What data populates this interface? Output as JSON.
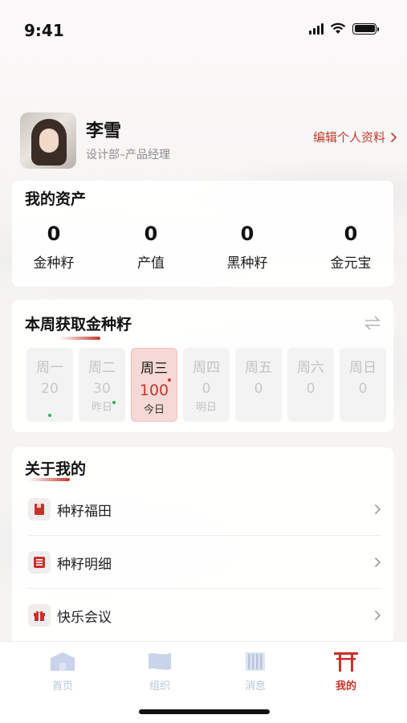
{
  "status": {
    "time": "9:41"
  },
  "profile": {
    "name": "李雪",
    "department": "设计部–产品经理",
    "edit_label": "编辑个人资料"
  },
  "assets": {
    "title": "我的资产",
    "items": [
      {
        "value": "0",
        "label": "金种籽"
      },
      {
        "value": "0",
        "label": "产值"
      },
      {
        "value": "0",
        "label": "黑种籽"
      },
      {
        "value": "0",
        "label": "金元宝"
      }
    ]
  },
  "weekly": {
    "title": "本周获取金种籽",
    "days": [
      {
        "name": "周一",
        "value": "20",
        "sub": ""
      },
      {
        "name": "周二",
        "value": "30",
        "sub": "昨日"
      },
      {
        "name": "周三",
        "value": "100",
        "sub": "今日"
      },
      {
        "name": "周四",
        "value": "0",
        "sub": "明日"
      },
      {
        "name": "周五",
        "value": "0",
        "sub": ""
      },
      {
        "name": "周六",
        "value": "0",
        "sub": ""
      },
      {
        "name": "周日",
        "value": "0",
        "sub": ""
      }
    ]
  },
  "about": {
    "title": "关于我的",
    "items": [
      {
        "label": "种籽福田",
        "icon": "book-icon"
      },
      {
        "label": "种籽明细",
        "icon": "list-icon"
      },
      {
        "label": "快乐会议",
        "icon": "gift-icon"
      }
    ]
  },
  "tabs": [
    {
      "label": "首页",
      "icon": "home-icon",
      "active": false
    },
    {
      "label": "组织",
      "icon": "organization-icon",
      "active": false
    },
    {
      "label": "消息",
      "icon": "message-icon",
      "active": false
    },
    {
      "label": "我的",
      "icon": "torii-gate-icon",
      "active": true
    }
  ],
  "colors": {
    "accent": "#c0392b",
    "today_bg": "#f6d9d6",
    "inactive_tab": "#b9c4da",
    "dot_green": "#2fae5a",
    "dot_red": "#d0342c"
  }
}
